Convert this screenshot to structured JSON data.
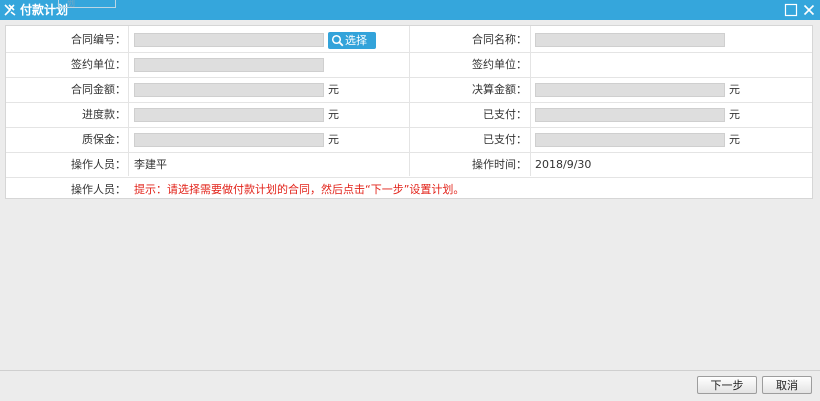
{
  "window": {
    "title": "付款计划",
    "ghost_tab": "划"
  },
  "form": {
    "contract_no": {
      "label": "合同编号：",
      "value": ""
    },
    "select_button": "选择",
    "contract_name": {
      "label": "合同名称：",
      "value": ""
    },
    "sign_unit_left": {
      "label": "签约单位：",
      "value": ""
    },
    "sign_unit_right": {
      "label": "签约单位：",
      "value": ""
    },
    "contract_amount": {
      "label": "合同金额：",
      "value": "",
      "unit": "元"
    },
    "settlement_amount": {
      "label": "决算金额：",
      "value": "",
      "unit": "元"
    },
    "progress_payment": {
      "label": "进度款：",
      "value": "",
      "unit": "元"
    },
    "paid_1": {
      "label": "已支付：",
      "value": "",
      "unit": "元"
    },
    "warranty_deposit": {
      "label": "质保金：",
      "value": "",
      "unit": "元"
    },
    "paid_2": {
      "label": "已支付：",
      "value": "",
      "unit": "元"
    },
    "operator": {
      "label": "操作人员：",
      "value": "李建平"
    },
    "operate_time": {
      "label": "操作时间：",
      "value": "2018/9/30"
    },
    "hint_row": {
      "label": "操作人员：",
      "hint": "提示：请选择需要做付款计划的合同，然后点击“下一步”设置计划。"
    }
  },
  "footer": {
    "next_label": "下一步",
    "cancel_label": "取消"
  },
  "colors": {
    "titlebar": "#35a6dc",
    "accent_button": "#33a3da",
    "hint_text": "#e2231a"
  }
}
